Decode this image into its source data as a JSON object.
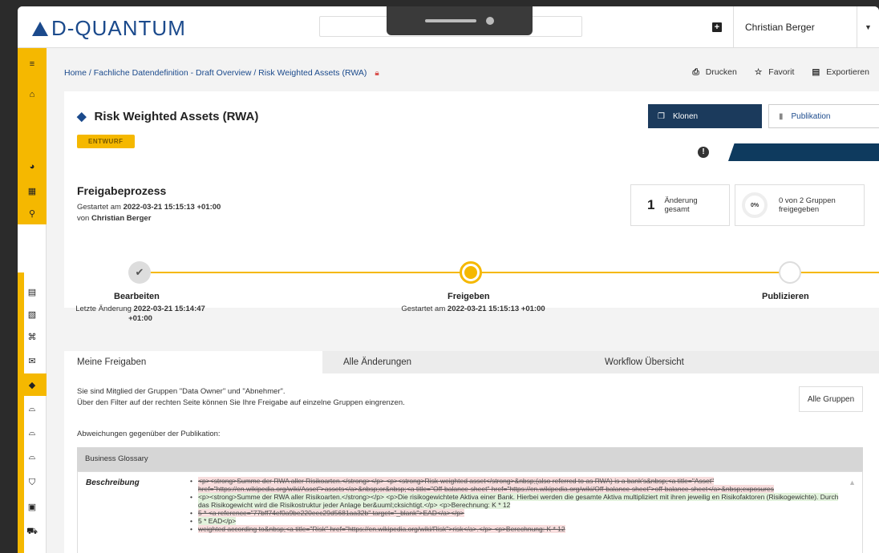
{
  "app": {
    "logo_text": "D-QUANTUM",
    "user_name": "Christian Berger"
  },
  "breadcrumb": {
    "text": "Home / Fachliche Datendefinition - Draft Overview / Risk Weighted Assets (RWA)"
  },
  "actions": {
    "print": "Drucken",
    "favorite": "Favorit",
    "export": "Exportieren"
  },
  "header": {
    "title": "Risk Weighted Assets (RWA)",
    "status_badge": "ENTWURF",
    "clone_button": "Klonen",
    "publish_button": "Publikation"
  },
  "process": {
    "title": "Freigabeprozess",
    "started_prefix": "Gestartet am ",
    "started_at": "2022-03-21 15:15:13 +01:00",
    "by_prefix": "von ",
    "by_name": "Christian Berger",
    "changes_count": "1",
    "changes_label": "Änderung gesamt",
    "progress_percent_label": "0%",
    "progress_fraction": 0,
    "groups_label": "0 von 2 Gruppen freigegeben"
  },
  "steps": [
    {
      "label": "Bearbeiten",
      "meta_prefix": "Letzte Änderung ",
      "meta_value": "2022-03-21 15:14:47 +01:00",
      "state": "done"
    },
    {
      "label": "Freigeben",
      "meta_prefix": "Gestartet am ",
      "meta_value": "2022-03-21 15:15:13 +01:00",
      "state": "current"
    },
    {
      "label": "Publizieren",
      "meta_prefix": "",
      "meta_value": "",
      "state": "pending"
    }
  ],
  "tabs": [
    {
      "label": "Meine Freigaben",
      "active": true
    },
    {
      "label": "Alle Änderungen",
      "active": false
    },
    {
      "label": "Workflow Übersicht",
      "active": false
    }
  ],
  "panel": {
    "info_line1": "Sie sind Mitglied der Gruppen \"Data Owner\" und \"Abnehmer\".",
    "info_line2": "Über den Filter auf der rechten Seite können Sie Ihre Freigabe auf einzelne Gruppen eingrenzen.",
    "groups_button": "Alle Gruppen",
    "deviations_label": "Abweichungen gegenüber der Publikation:",
    "glossary_header": "Business Glossary",
    "field_label": "Beschreibung",
    "diff_lines": [
      {
        "type": "del",
        "text": "<p><strong>Summe der RWA aller Risikoarten.</strong></p> <p><strong>Risk-weighted asset</strong>&nbsp;(also referred to as RWA) is a bank's&nbsp;<a title=\"Asset\" href=\"https://en.wikipedia.org/wiki/Asset\">assets</a>&nbsp;or&nbsp;<a title=\"Off-balance-sheet\" href=\"https://en.wikipedia.org/wiki/Off-balance-sheet\">off-balance-sheet</a>&nbsp;exposures"
      },
      {
        "type": "ins",
        "text": "<p><strong>Summe der RWA aller Risikoarten.</strong></p> <p>Die risikogewichtete Aktiva einer Bank. Hierbei werden die gesamte Aktiva multipliziert mit ihren jeweilig en Risikofaktoren (Risikogewichte). Durch das Risikogewicht wird die Risikostruktur jeder Anlage ber&uuml;cksichtigt.</p> <p>Berechnung: K * 12"
      },
      {
        "type": "del",
        "text": "5 * <a reference=\"77bff74ef0a9be220eec29d5681aa32b\" target=\"_blank\">EAD</a></p>"
      },
      {
        "type": "ins",
        "text": "5 * EAD</p>"
      },
      {
        "type": "del",
        "text": "weighted according to&nbsp;<a title=\"Risk\" href=\"https://en.wikipedia.org/wiki/Risk\">risk</a>.</p> <p>Berechnung: K * 12"
      }
    ]
  },
  "colors": {
    "accent": "#f5b800",
    "primary": "#1b3a5c",
    "brand": "#1b4a8c"
  }
}
